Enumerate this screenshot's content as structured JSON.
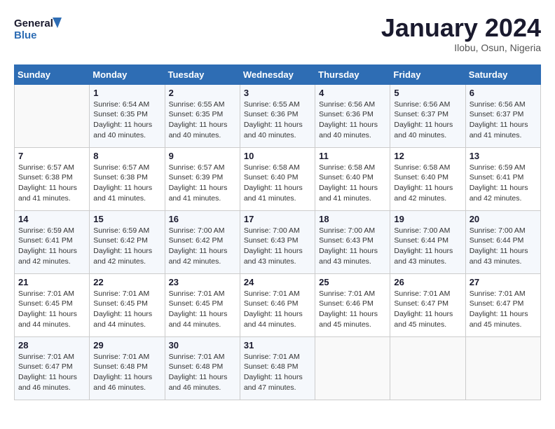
{
  "header": {
    "logo_line1": "General",
    "logo_line2": "Blue",
    "month": "January 2024",
    "location": "Ilobu, Osun, Nigeria"
  },
  "days_of_week": [
    "Sunday",
    "Monday",
    "Tuesday",
    "Wednesday",
    "Thursday",
    "Friday",
    "Saturday"
  ],
  "weeks": [
    [
      {
        "day": "",
        "info": ""
      },
      {
        "day": "1",
        "info": "Sunrise: 6:54 AM\nSunset: 6:35 PM\nDaylight: 11 hours\nand 40 minutes."
      },
      {
        "day": "2",
        "info": "Sunrise: 6:55 AM\nSunset: 6:35 PM\nDaylight: 11 hours\nand 40 minutes."
      },
      {
        "day": "3",
        "info": "Sunrise: 6:55 AM\nSunset: 6:36 PM\nDaylight: 11 hours\nand 40 minutes."
      },
      {
        "day": "4",
        "info": "Sunrise: 6:56 AM\nSunset: 6:36 PM\nDaylight: 11 hours\nand 40 minutes."
      },
      {
        "day": "5",
        "info": "Sunrise: 6:56 AM\nSunset: 6:37 PM\nDaylight: 11 hours\nand 40 minutes."
      },
      {
        "day": "6",
        "info": "Sunrise: 6:56 AM\nSunset: 6:37 PM\nDaylight: 11 hours\nand 41 minutes."
      }
    ],
    [
      {
        "day": "7",
        "info": "Sunrise: 6:57 AM\nSunset: 6:38 PM\nDaylight: 11 hours\nand 41 minutes."
      },
      {
        "day": "8",
        "info": "Sunrise: 6:57 AM\nSunset: 6:38 PM\nDaylight: 11 hours\nand 41 minutes."
      },
      {
        "day": "9",
        "info": "Sunrise: 6:57 AM\nSunset: 6:39 PM\nDaylight: 11 hours\nand 41 minutes."
      },
      {
        "day": "10",
        "info": "Sunrise: 6:58 AM\nSunset: 6:40 PM\nDaylight: 11 hours\nand 41 minutes."
      },
      {
        "day": "11",
        "info": "Sunrise: 6:58 AM\nSunset: 6:40 PM\nDaylight: 11 hours\nand 41 minutes."
      },
      {
        "day": "12",
        "info": "Sunrise: 6:58 AM\nSunset: 6:40 PM\nDaylight: 11 hours\nand 42 minutes."
      },
      {
        "day": "13",
        "info": "Sunrise: 6:59 AM\nSunset: 6:41 PM\nDaylight: 11 hours\nand 42 minutes."
      }
    ],
    [
      {
        "day": "14",
        "info": "Sunrise: 6:59 AM\nSunset: 6:41 PM\nDaylight: 11 hours\nand 42 minutes."
      },
      {
        "day": "15",
        "info": "Sunrise: 6:59 AM\nSunset: 6:42 PM\nDaylight: 11 hours\nand 42 minutes."
      },
      {
        "day": "16",
        "info": "Sunrise: 7:00 AM\nSunset: 6:42 PM\nDaylight: 11 hours\nand 42 minutes."
      },
      {
        "day": "17",
        "info": "Sunrise: 7:00 AM\nSunset: 6:43 PM\nDaylight: 11 hours\nand 43 minutes."
      },
      {
        "day": "18",
        "info": "Sunrise: 7:00 AM\nSunset: 6:43 PM\nDaylight: 11 hours\nand 43 minutes."
      },
      {
        "day": "19",
        "info": "Sunrise: 7:00 AM\nSunset: 6:44 PM\nDaylight: 11 hours\nand 43 minutes."
      },
      {
        "day": "20",
        "info": "Sunrise: 7:00 AM\nSunset: 6:44 PM\nDaylight: 11 hours\nand 43 minutes."
      }
    ],
    [
      {
        "day": "21",
        "info": "Sunrise: 7:01 AM\nSunset: 6:45 PM\nDaylight: 11 hours\nand 44 minutes."
      },
      {
        "day": "22",
        "info": "Sunrise: 7:01 AM\nSunset: 6:45 PM\nDaylight: 11 hours\nand 44 minutes."
      },
      {
        "day": "23",
        "info": "Sunrise: 7:01 AM\nSunset: 6:45 PM\nDaylight: 11 hours\nand 44 minutes."
      },
      {
        "day": "24",
        "info": "Sunrise: 7:01 AM\nSunset: 6:46 PM\nDaylight: 11 hours\nand 44 minutes."
      },
      {
        "day": "25",
        "info": "Sunrise: 7:01 AM\nSunset: 6:46 PM\nDaylight: 11 hours\nand 45 minutes."
      },
      {
        "day": "26",
        "info": "Sunrise: 7:01 AM\nSunset: 6:47 PM\nDaylight: 11 hours\nand 45 minutes."
      },
      {
        "day": "27",
        "info": "Sunrise: 7:01 AM\nSunset: 6:47 PM\nDaylight: 11 hours\nand 45 minutes."
      }
    ],
    [
      {
        "day": "28",
        "info": "Sunrise: 7:01 AM\nSunset: 6:47 PM\nDaylight: 11 hours\nand 46 minutes."
      },
      {
        "day": "29",
        "info": "Sunrise: 7:01 AM\nSunset: 6:48 PM\nDaylight: 11 hours\nand 46 minutes."
      },
      {
        "day": "30",
        "info": "Sunrise: 7:01 AM\nSunset: 6:48 PM\nDaylight: 11 hours\nand 46 minutes."
      },
      {
        "day": "31",
        "info": "Sunrise: 7:01 AM\nSunset: 6:48 PM\nDaylight: 11 hours\nand 47 minutes."
      },
      {
        "day": "",
        "info": ""
      },
      {
        "day": "",
        "info": ""
      },
      {
        "day": "",
        "info": ""
      }
    ]
  ]
}
